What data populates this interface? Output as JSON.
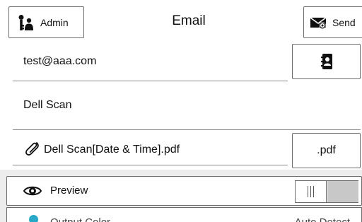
{
  "header": {
    "admin_label": "Admin",
    "title": "Email",
    "send_label": "Send"
  },
  "recipient": {
    "value": "test@aaa.com"
  },
  "subject": {
    "value": "Dell Scan"
  },
  "attachment": {
    "filename": "Dell Scan[Date & Time].pdf",
    "format": ".pdf"
  },
  "options": {
    "preview_label": "Preview",
    "preview_enabled": false,
    "output_color_label": "Output Color",
    "output_color_value": "Auto Detect"
  },
  "icons": {
    "admin": "admin-key-icon",
    "send": "send-envelope-icon",
    "address_book": "address-book-icon",
    "attachment": "paperclip-icon",
    "preview": "eye-icon",
    "output_color": "color-icon"
  }
}
